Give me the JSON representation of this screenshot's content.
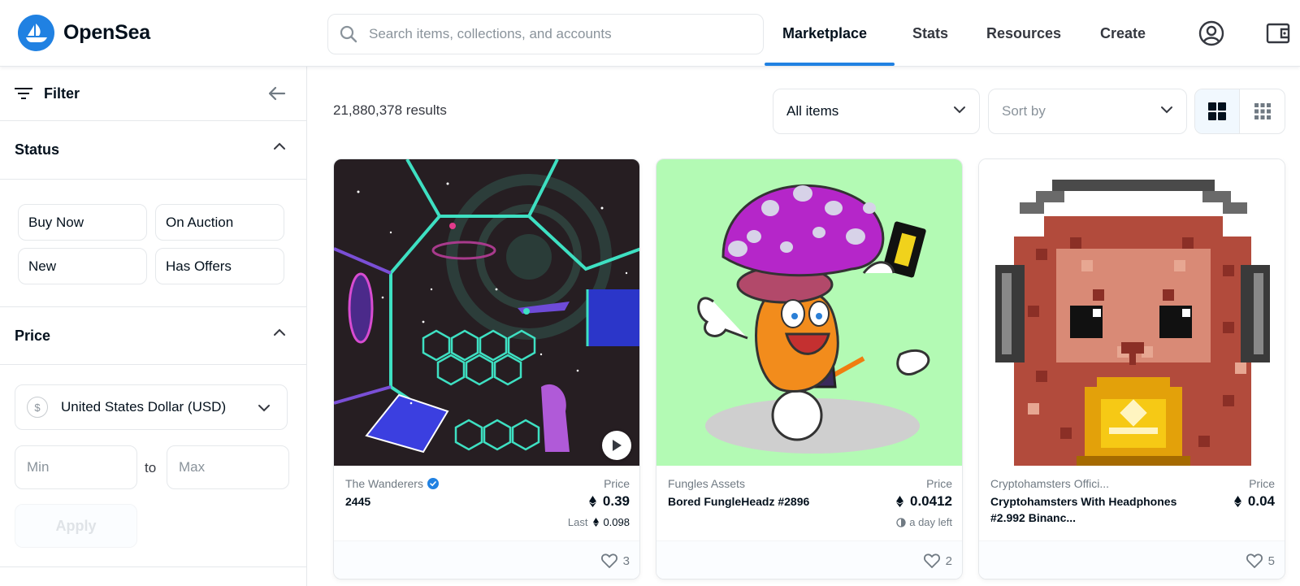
{
  "header": {
    "logo_text": "OpenSea",
    "search_placeholder": "Search items, collections, and accounts",
    "nav": [
      "Marketplace",
      "Stats",
      "Resources",
      "Create"
    ],
    "active_nav": "Marketplace"
  },
  "sidebar": {
    "filter_label": "Filter",
    "status": {
      "title": "Status",
      "options": [
        "Buy Now",
        "On Auction",
        "New",
        "Has Offers"
      ]
    },
    "price": {
      "title": "Price",
      "currency": "United States Dollar (USD)",
      "currency_symbol": "$",
      "min_placeholder": "Min",
      "to_label": "to",
      "max_placeholder": "Max",
      "apply_label": "Apply"
    }
  },
  "toolbar": {
    "results": "21,880,378 results",
    "items_filter": "All items",
    "sort_placeholder": "Sort by"
  },
  "cards": [
    {
      "collection": "The Wanderers",
      "verified": true,
      "name": "2445",
      "price_label": "Price",
      "price": "0.39",
      "sub_prefix": "Last",
      "sub_value": "0.098",
      "likes": "3",
      "image": "space-station-hexagons"
    },
    {
      "collection": "Fungles Assets",
      "verified": false,
      "name": "Bored FungleHeadz #2896",
      "price_label": "Price",
      "price": "0.0412",
      "sub_value": "a day left",
      "likes": "2",
      "image": "cartoon-mushroom"
    },
    {
      "collection": "Cryptohamsters Offici...",
      "verified": false,
      "name": "Cryptohamsters With Headphones #2.992 Binanc...",
      "price_label": "Price",
      "price": "0.04",
      "likes": "5",
      "image": "pixel-hamster-headphones"
    }
  ],
  "colors": {
    "accent": "#2081e2",
    "text": "#04111d",
    "muted": "#707a83",
    "border": "#e5e8eb"
  }
}
